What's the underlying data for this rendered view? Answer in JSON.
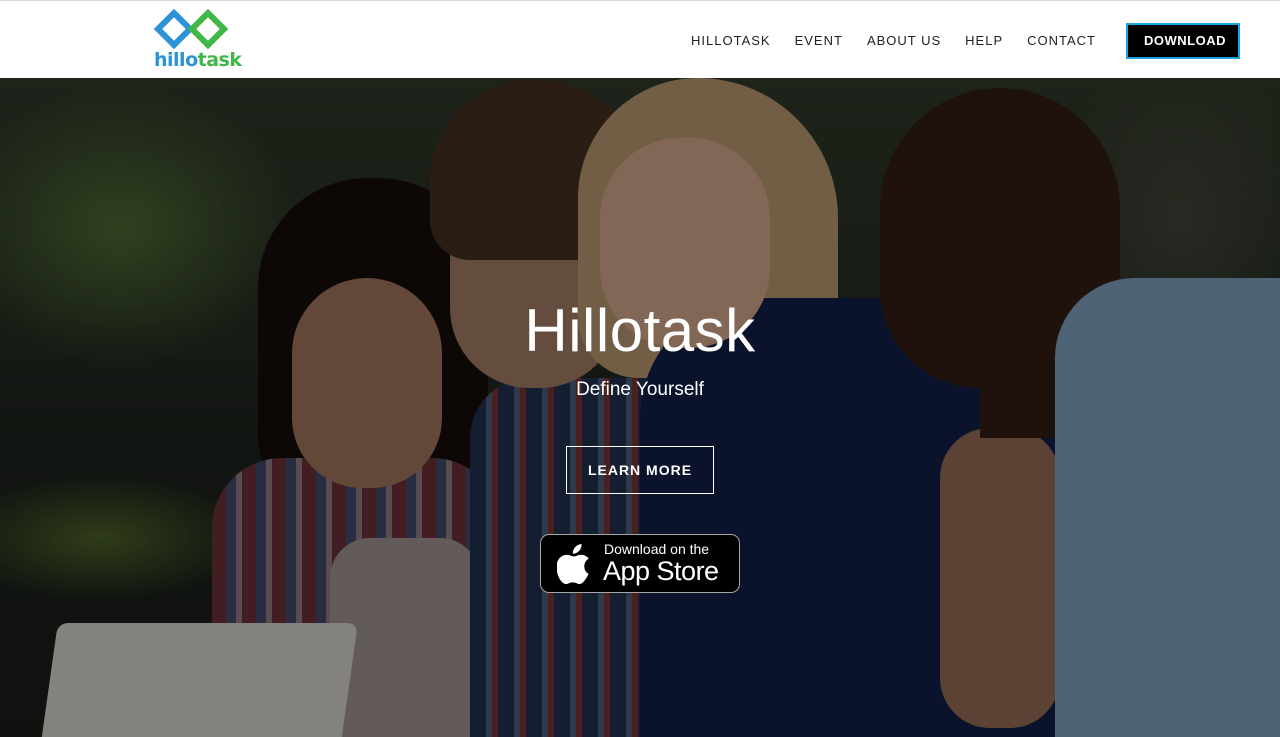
{
  "brand": {
    "logo_text_part1": "hillo",
    "logo_text_part2": "task",
    "icon": "infinity-logo-icon",
    "colors": {
      "blue": "#2b93d6",
      "green": "#41b649"
    }
  },
  "nav": {
    "items": [
      {
        "label": "HILLOTASK"
      },
      {
        "label": "EVENT"
      },
      {
        "label": "ABOUT US"
      },
      {
        "label": "HELP"
      },
      {
        "label": "CONTACT"
      }
    ],
    "download_label": "DOWNLOAD",
    "download_border_color": "#1aa4e0"
  },
  "hero": {
    "title": "Hillotask",
    "subtitle": "Define Yourself",
    "learn_more_label": "LEARN MORE",
    "app_store": {
      "line1": "Download on the",
      "line2": "App Store",
      "icon": "apple-icon"
    }
  }
}
